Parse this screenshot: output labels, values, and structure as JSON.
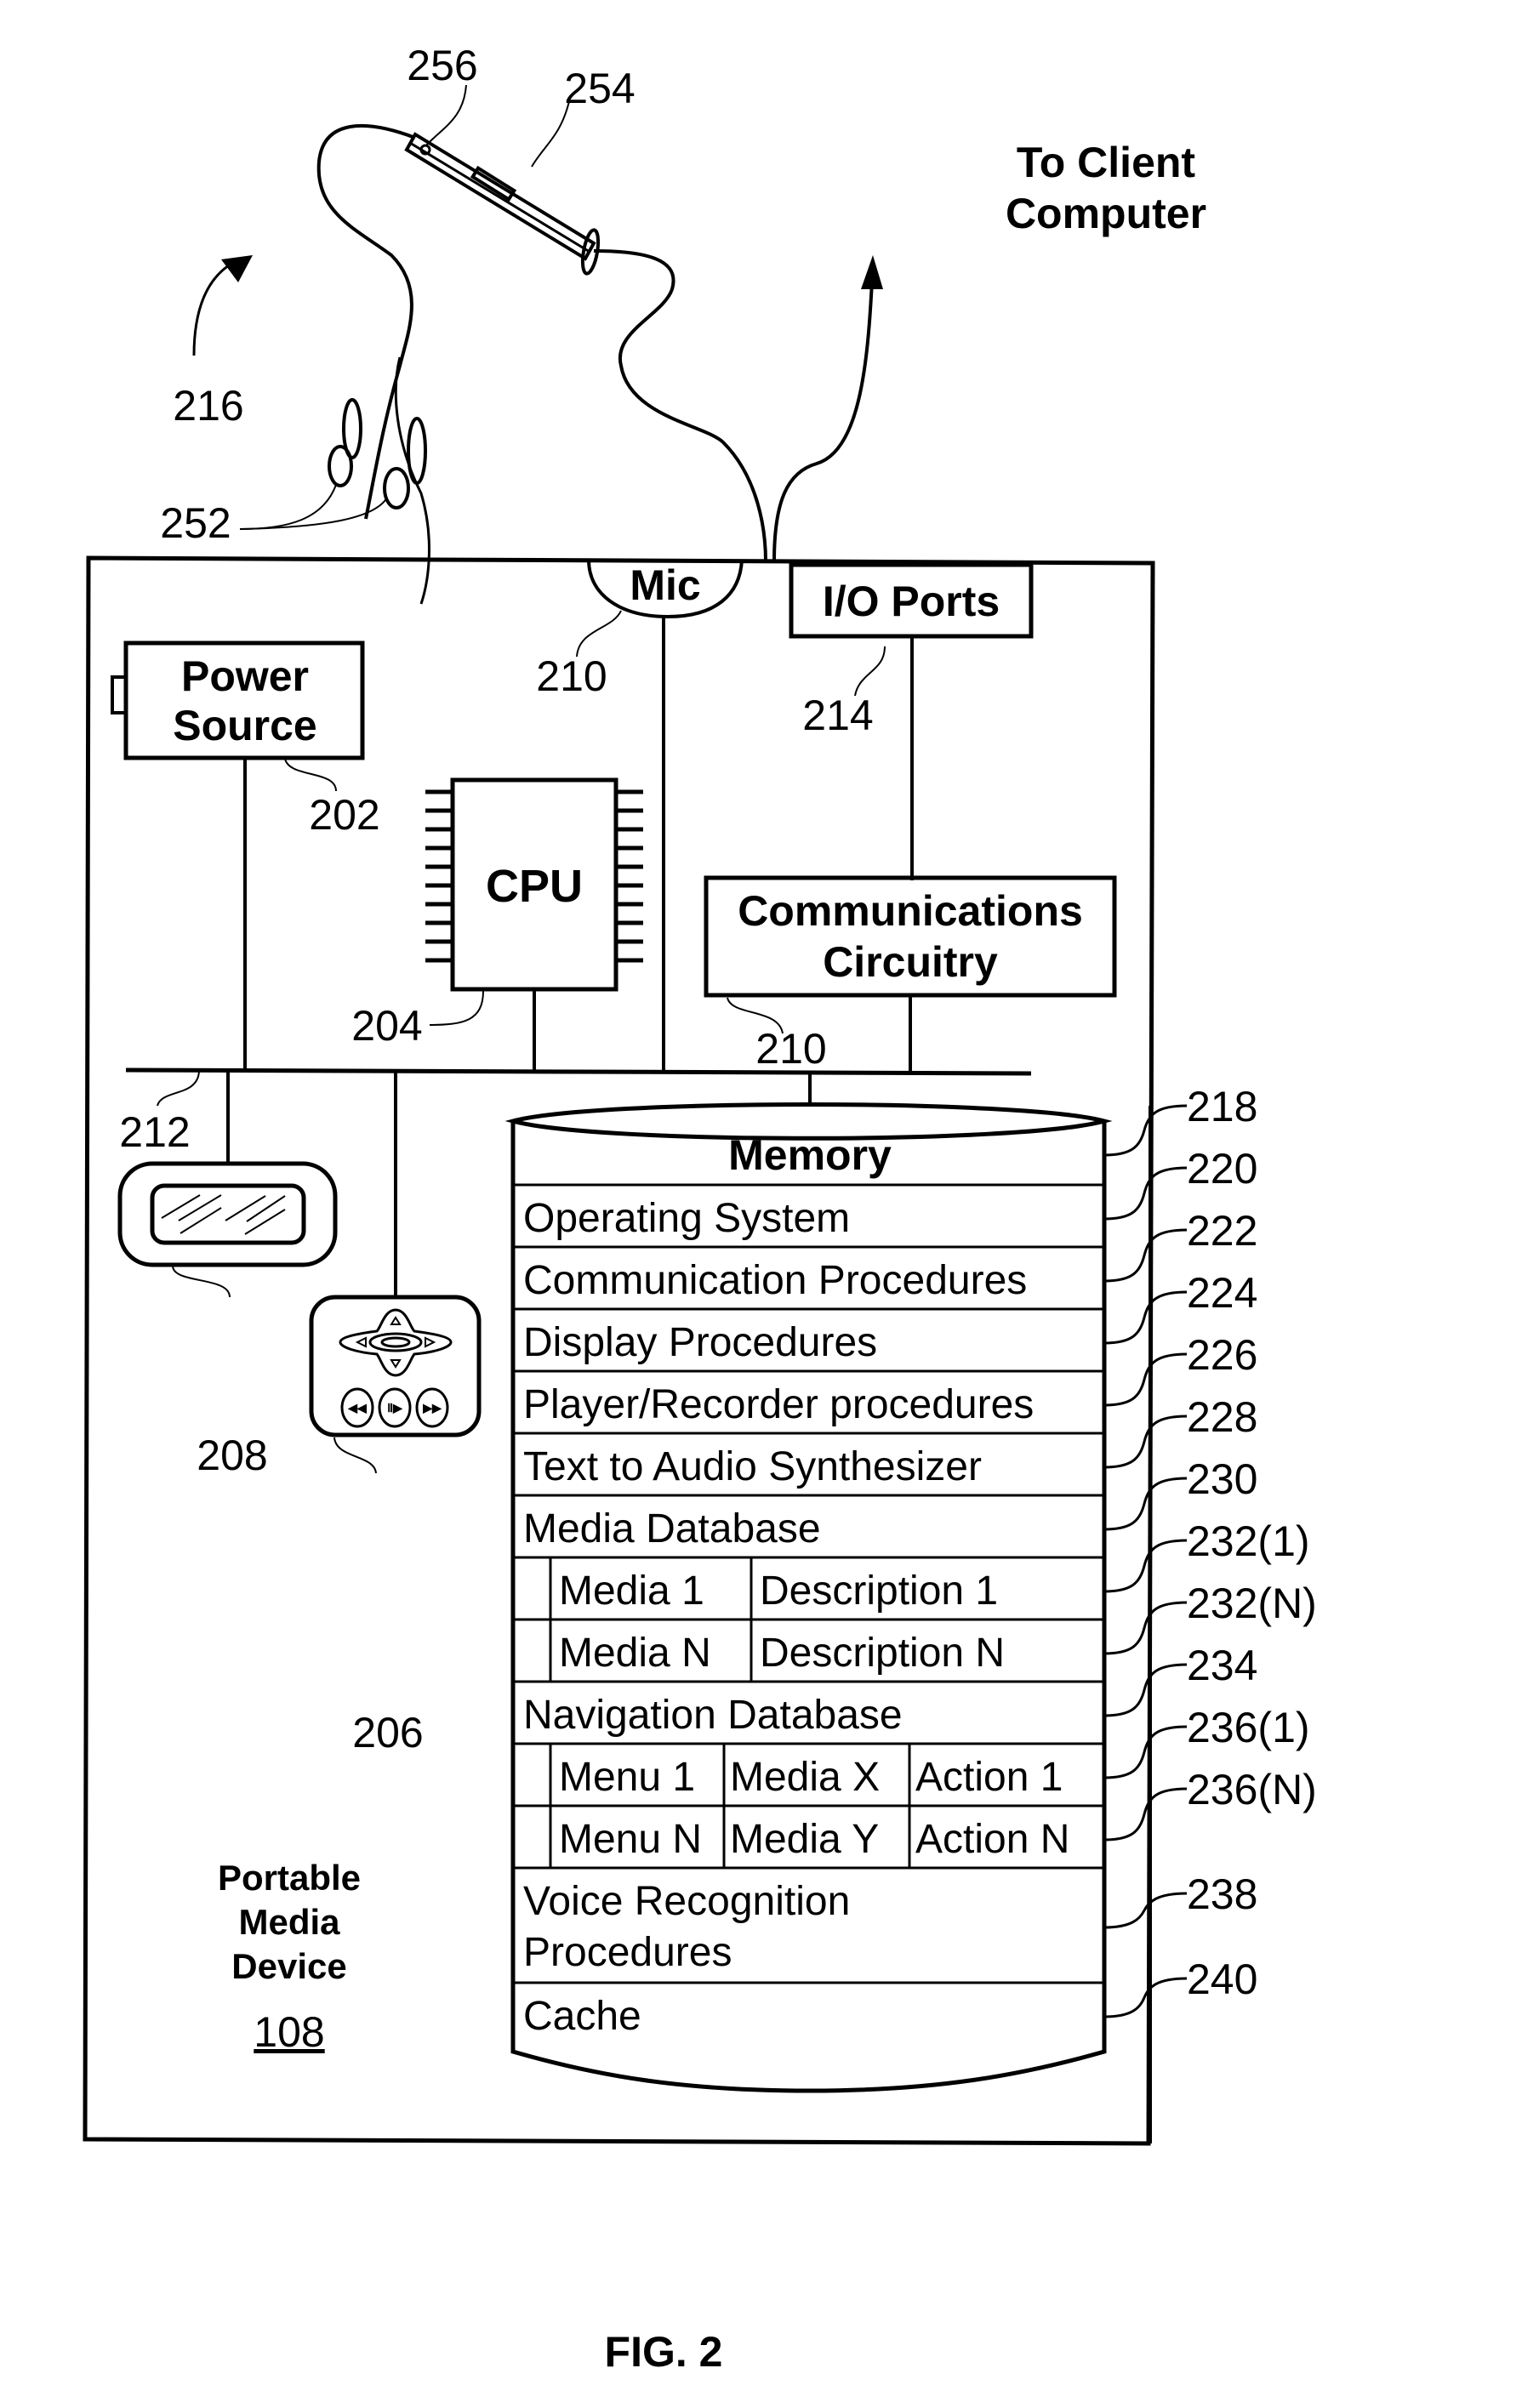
{
  "figure": {
    "caption": "FIG. 2",
    "device_label": [
      "Portable",
      "Media",
      "Device"
    ],
    "device_ref": "108",
    "to_client": [
      "To Client",
      "Computer"
    ]
  },
  "components": {
    "power_source": {
      "label": [
        "Power",
        "Source"
      ],
      "ref": "202"
    },
    "cpu": {
      "label": "CPU",
      "ref": "204"
    },
    "mic": {
      "label": "Mic",
      "ref": "210"
    },
    "io_ports": {
      "label": "I/O Ports",
      "ref": "214"
    },
    "comm_circuitry": {
      "label": [
        "Communications",
        "Circuitry"
      ],
      "ref": "210"
    },
    "bus": {
      "ref": "212"
    },
    "display": {
      "ref": "208"
    },
    "controls": {
      "ref": "206"
    },
    "headset": {
      "ref": "216",
      "earbuds_ref": "252",
      "remote_ref": "254",
      "button_ref": "256"
    }
  },
  "memory": {
    "title": "Memory",
    "ref": "218",
    "rows": [
      {
        "label": "Operating System",
        "ref": "220"
      },
      {
        "label": "Communication Procedures",
        "ref": "222"
      },
      {
        "label": "Display Procedures",
        "ref": "224"
      },
      {
        "label": "Player/Recorder procedures",
        "ref": "226"
      },
      {
        "label": "Text to Audio Synthesizer",
        "ref": "228"
      },
      {
        "label": "Media Database",
        "ref": "230"
      }
    ],
    "media_entries": [
      {
        "cells": [
          "Media 1",
          "Description 1"
        ],
        "ref": "232(1)"
      },
      {
        "cells": [
          "Media N",
          "Description N"
        ],
        "ref": "232(N)"
      }
    ],
    "nav_db": {
      "label": "Navigation Database",
      "ref": "234"
    },
    "nav_entries": [
      {
        "cells": [
          "Menu 1",
          "Media X",
          "Action 1"
        ],
        "ref": "236(1)"
      },
      {
        "cells": [
          "Menu N",
          "Media Y",
          "Action N"
        ],
        "ref": "236(N)"
      }
    ],
    "voice": {
      "label": [
        "Voice Recognition",
        "Procedures"
      ],
      "ref": "238"
    },
    "cache": {
      "label": "Cache",
      "ref": "240"
    }
  }
}
